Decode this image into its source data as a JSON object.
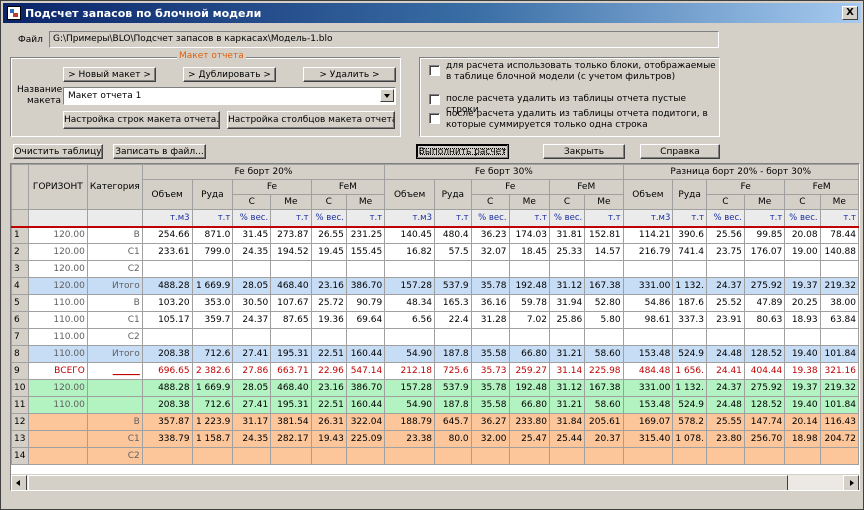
{
  "window": {
    "title": "Подсчет запасов по блочной модели",
    "close_glyph": "X"
  },
  "file": {
    "label": "Файл",
    "path": "G:\\Примеры\\BLO\\Подсчет запасов в каркасах\\Модель-1.blo"
  },
  "layout_group": {
    "legend": "Макет отчета",
    "name_label_1": "Название",
    "name_label_2": "макета",
    "new_button": "> Новый макет >",
    "duplicate_button": "> Дублировать >",
    "delete_button": "> Удалить >",
    "selected_layout": "Макет отчета 1",
    "rows_setup_button": "Настройка строк макета отчета...",
    "cols_setup_button": "Настройка столбцов макета отчета..."
  },
  "options": {
    "only_visible_blocks": "для расчета использовать только блоки, отображаемые в таблице блочной модели (с учетом фильтров)",
    "only_visible_blocks_checked": false,
    "delete_empty_rows": "после расчета удалить из таблицы отчета пустые строки",
    "delete_empty_rows_checked": false,
    "delete_single_subtotals": "после расчета удалить из таблицы отчета подитоги, в которые суммируется только одна строка",
    "delete_single_subtotals_checked": false
  },
  "toolbar": {
    "clear_button": "Очистить таблицу",
    "save_button": "Записать в файл...",
    "run_button": "Выполнить расчет",
    "close_button": "Закрыть",
    "help_button": "Справка"
  },
  "grid": {
    "col_horizon": "ГОРИЗОНТ",
    "col_category": "Категория",
    "groups": [
      "Fe борт 20%",
      "Fe борт 30%",
      "Разница борт 20% - борт 30%"
    ],
    "sub_volume": "Объем",
    "sub_ore": "Руда",
    "sub_fe": "Fe",
    "sub_fem": "FeM",
    "sub_c": "С",
    "sub_me": "Ме",
    "units": [
      "т.м3",
      "т.т",
      "% вес.",
      "т.т",
      "% вес.",
      "т.т",
      "т.м3",
      "т.т",
      "% вес.",
      "т.т",
      "% вес.",
      "т.т",
      "т.м3",
      "т.т",
      "% вес.",
      "т.т",
      "% вес.",
      "т.т"
    ],
    "rows": [
      {
        "n": "1",
        "h": "120.00",
        "c": "В",
        "type": "norm",
        "v": [
          "254.66",
          "871.0",
          "31.45",
          "273.87",
          "26.55",
          "231.25",
          "140.45",
          "480.4",
          "36.23",
          "174.03",
          "31.81",
          "152.81",
          "114.21",
          "390.6",
          "25.56",
          "99.85",
          "20.08",
          "78.44"
        ]
      },
      {
        "n": "2",
        "h": "120.00",
        "c": "С1",
        "type": "norm",
        "v": [
          "233.61",
          "799.0",
          "24.35",
          "194.52",
          "19.45",
          "155.45",
          "16.82",
          "57.5",
          "32.07",
          "18.45",
          "25.33",
          "14.57",
          "216.79",
          "741.4",
          "23.75",
          "176.07",
          "19.00",
          "140.88"
        ]
      },
      {
        "n": "3",
        "h": "120.00",
        "c": "С2",
        "type": "norm",
        "v": [
          "",
          "",
          "",
          "",
          "",
          "",
          "",
          "",
          "",
          "",
          "",
          "",
          "",
          "",
          "",
          "",
          "",
          ""
        ]
      },
      {
        "n": "4",
        "h": "120.00",
        "c": "Итого",
        "type": "itogo",
        "v": [
          "488.28",
          "1 669.9",
          "28.05",
          "468.40",
          "23.16",
          "386.70",
          "157.28",
          "537.9",
          "35.78",
          "192.48",
          "31.12",
          "167.38",
          "331.00",
          "1 132.",
          "24.37",
          "275.92",
          "19.37",
          "219.32"
        ]
      },
      {
        "n": "5",
        "h": "110.00",
        "c": "В",
        "type": "norm",
        "v": [
          "103.20",
          "353.0",
          "30.50",
          "107.67",
          "25.72",
          "90.79",
          "48.34",
          "165.3",
          "36.16",
          "59.78",
          "31.94",
          "52.80",
          "54.86",
          "187.6",
          "25.52",
          "47.89",
          "20.25",
          "38.00"
        ]
      },
      {
        "n": "6",
        "h": "110.00",
        "c": "С1",
        "type": "norm",
        "v": [
          "105.17",
          "359.7",
          "24.37",
          "87.65",
          "19.36",
          "69.64",
          "6.56",
          "22.4",
          "31.28",
          "7.02",
          "25.86",
          "5.80",
          "98.61",
          "337.3",
          "23.91",
          "80.63",
          "18.93",
          "63.84"
        ]
      },
      {
        "n": "7",
        "h": "110.00",
        "c": "С2",
        "type": "norm",
        "v": [
          "",
          "",
          "",
          "",
          "",
          "",
          "",
          "",
          "",
          "",
          "",
          "",
          "",
          "",
          "",
          "",
          "",
          ""
        ]
      },
      {
        "n": "8",
        "h": "110.00",
        "c": "Итого",
        "type": "itogo",
        "v": [
          "208.38",
          "712.6",
          "27.41",
          "195.31",
          "22.51",
          "160.44",
          "54.90",
          "187.8",
          "35.58",
          "66.80",
          "31.21",
          "58.60",
          "153.48",
          "524.9",
          "24.48",
          "128.52",
          "19.40",
          "101.84"
        ]
      },
      {
        "n": "9",
        "h": "ВСЕГО",
        "c": "______",
        "type": "vsego",
        "v": [
          "696.65",
          "2 382.6",
          "27.86",
          "663.71",
          "22.96",
          "547.14",
          "212.18",
          "725.6",
          "35.73",
          "259.27",
          "31.14",
          "225.98",
          "484.48",
          "1 656.",
          "24.41",
          "404.44",
          "19.38",
          "321.16"
        ]
      },
      {
        "n": "10",
        "h": "120.00",
        "c": "",
        "type": "green",
        "v": [
          "488.28",
          "1 669.9",
          "28.05",
          "468.40",
          "23.16",
          "386.70",
          "157.28",
          "537.9",
          "35.78",
          "192.48",
          "31.12",
          "167.38",
          "331.00",
          "1 132.",
          "24.37",
          "275.92",
          "19.37",
          "219.32"
        ]
      },
      {
        "n": "11",
        "h": "110.00",
        "c": "",
        "type": "green",
        "v": [
          "208.38",
          "712.6",
          "27.41",
          "195.31",
          "22.51",
          "160.44",
          "54.90",
          "187.8",
          "35.58",
          "66.80",
          "31.21",
          "58.60",
          "153.48",
          "524.9",
          "24.48",
          "128.52",
          "19.40",
          "101.84"
        ]
      },
      {
        "n": "12",
        "h": "",
        "c": "В",
        "type": "orange",
        "v": [
          "357.87",
          "1 223.9",
          "31.17",
          "381.54",
          "26.31",
          "322.04",
          "188.79",
          "645.7",
          "36.27",
          "233.80",
          "31.84",
          "205.61",
          "169.07",
          "578.2",
          "25.55",
          "147.74",
          "20.14",
          "116.43"
        ]
      },
      {
        "n": "13",
        "h": "",
        "c": "С1",
        "type": "orange",
        "v": [
          "338.79",
          "1 158.7",
          "24.35",
          "282.17",
          "19.43",
          "225.09",
          "23.38",
          "80.0",
          "32.00",
          "25.47",
          "25.44",
          "20.37",
          "315.40",
          "1 078.",
          "23.80",
          "256.70",
          "18.98",
          "204.72"
        ]
      },
      {
        "n": "14",
        "h": "",
        "c": "С2",
        "type": "orange",
        "v": [
          "",
          "",
          "",
          "",
          "",
          "",
          "",
          "",
          "",
          "",
          "",
          "",
          "",
          "",
          "",
          "",
          "",
          ""
        ]
      }
    ]
  }
}
